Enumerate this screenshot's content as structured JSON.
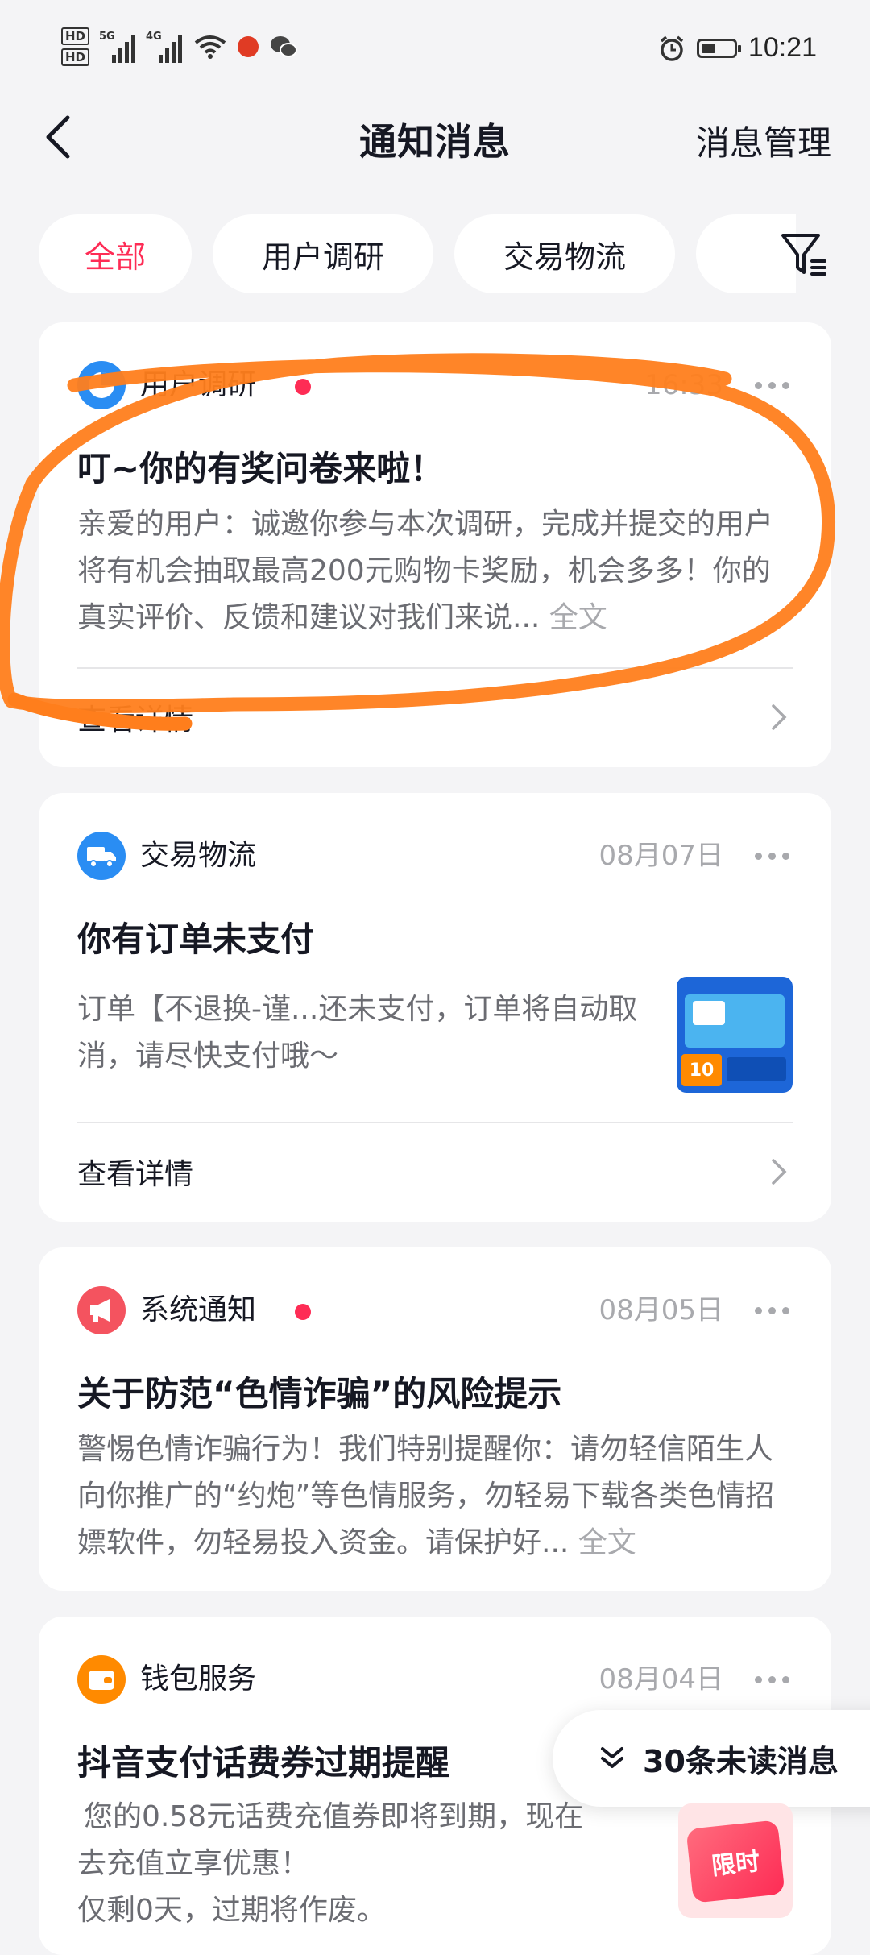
{
  "status_bar": {
    "time": "10:21",
    "hd1": "HD",
    "hd2": "HD",
    "net1": "5G",
    "net2": "4G",
    "battery_level": 0.45
  },
  "header": {
    "title": "通知消息",
    "manage": "消息管理"
  },
  "tabs": [
    "全部",
    "用户调研",
    "交易物流"
  ],
  "cards": [
    {
      "category": "用户调研",
      "time": "16:33",
      "title": "叮~你的有奖问卷来啦！",
      "body": "亲爱的用户：诚邀你参与本次调研，完成并提交的用户将有机会抽取最高200元购物卡奖励，机会多多！你的真实评价、反馈和建议对我们来说...",
      "full_text": "全文",
      "detail": "查看详情"
    },
    {
      "category": "交易物流",
      "time": "08月07日",
      "title": "你有订单未支付",
      "body": "订单【不退换-谨...还未支付，订单将自动取消，请尽快支付哦～",
      "detail": "查看详情",
      "thumb_text": "10"
    },
    {
      "category": "系统通知",
      "time": "08月05日",
      "title": "关于防范“色情诈骗”的风险提示",
      "body": "警惕色情诈骗行为！我们特别提醒你：请勿轻信陌生人向你推广的“约炮”等色情服务，勿轻易下载各类色情招嫖软件，勿轻易投入资金。请保护好...",
      "full_text": "全文"
    },
    {
      "category": "钱包服务",
      "time": "08月04日",
      "title": "抖音支付话费券过期提醒",
      "body_line1": "您的0.58元话费充值券即将到期，现在",
      "body_line2": "去充值立享优惠！",
      "body_line3": "仅剩0天，过期将作废。"
    }
  ],
  "unread": "30条未读消息",
  "promo_badge": "限时"
}
